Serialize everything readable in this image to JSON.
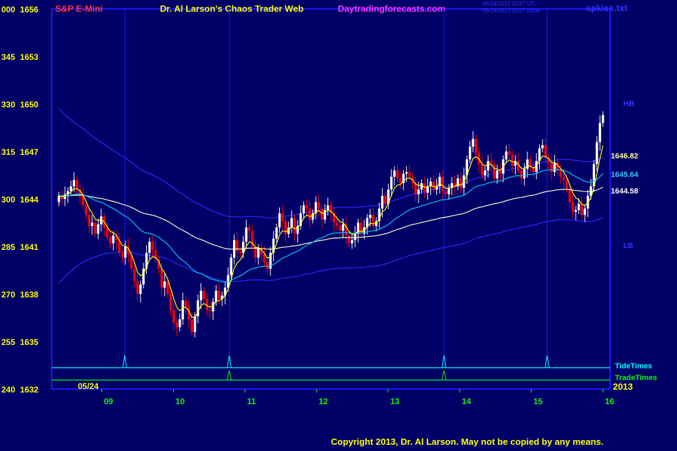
{
  "header": {
    "symbol": "S&P E-Mini",
    "title": "Dr. Al Larson's Chaos Trader Web",
    "site": "Daytradingforecasts.com",
    "stamp1": "05/24/2013 20:07 UT",
    "stamp2": "05/24/2013 15:07 Local",
    "file": "spkiss.txt"
  },
  "footer": {
    "copyright": "Copyright 2013, Dr. Al Larson. May not be copied by any means."
  },
  "colors": {
    "background": "#000066",
    "frame": "#1a1aff",
    "up_candle": "#ffffff",
    "down_candle": "#ff0000",
    "fast_avg": "#ffff00",
    "mid_avg": "#00ccff",
    "slow_avg": "#ffffcc",
    "bands": "#2a2aff",
    "tide": "#00ffff",
    "trade": "#00ff00"
  },
  "chart_data": {
    "type": "candlestick",
    "title": "S&P E-Mini",
    "date_label": "05/24",
    "year_label": "2013",
    "y_axis": {
      "range": [
        1632,
        1656
      ],
      "ticks": [
        {
          "left": "000",
          "price": "1656",
          "value": 1656
        },
        {
          "left": "345",
          "price": "1653",
          "value": 1653
        },
        {
          "left": "330",
          "price": "1650",
          "value": 1650
        },
        {
          "left": "315",
          "price": "1647",
          "value": 1647
        },
        {
          "left": "300",
          "price": "1644",
          "value": 1644
        },
        {
          "left": "285",
          "price": "1641",
          "value": 1641
        },
        {
          "left": "270",
          "price": "1638",
          "value": 1638
        },
        {
          "left": "255",
          "price": "1635",
          "value": 1635
        },
        {
          "left": "240",
          "price": "1632",
          "value": 1632
        }
      ]
    },
    "x_axis": {
      "range_hours": [
        8.3,
        16.1
      ],
      "ticks": [
        {
          "label": "09",
          "hour": 9
        },
        {
          "label": "10",
          "hour": 10
        },
        {
          "label": "11",
          "hour": 11
        },
        {
          "label": "12",
          "hour": 12
        },
        {
          "label": "13",
          "hour": 13
        },
        {
          "label": "14",
          "hour": 14
        },
        {
          "label": "15",
          "hour": 15
        },
        {
          "label": "16",
          "hour": 16
        }
      ]
    },
    "candle_closes": [
      1644.2,
      1644.0,
      1644.3,
      1644.5,
      1644.8,
      1645.2,
      1644.6,
      1644.2,
      1643.6,
      1643.0,
      1642.3,
      1642.5,
      1641.8,
      1642.4,
      1642.9,
      1642.2,
      1641.6,
      1641.2,
      1641.7,
      1641.4,
      1640.6,
      1640.3,
      1641.0,
      1640.5,
      1639.6,
      1638.8,
      1638.0,
      1638.6,
      1639.6,
      1640.6,
      1641.3,
      1640.8,
      1640.2,
      1639.6,
      1638.4,
      1638.8,
      1638.0,
      1637.0,
      1636.2,
      1635.9,
      1636.4,
      1637.6,
      1637.2,
      1636.4,
      1635.6,
      1636.6,
      1637.6,
      1638.2,
      1637.7,
      1637.0,
      1636.9,
      1637.5,
      1638.2,
      1637.7,
      1637.9,
      1638.4,
      1639.2,
      1640.3,
      1641.4,
      1640.7,
      1640.6,
      1641.3,
      1642.2,
      1642.0,
      1641.0,
      1640.3,
      1640.9,
      1640.5,
      1640.0,
      1639.6,
      1640.6,
      1641.5,
      1642.2,
      1643.1,
      1642.6,
      1641.8,
      1642.2,
      1642.8,
      1641.8,
      1642.3,
      1643.1,
      1643.6,
      1643.4,
      1642.7,
      1643.1,
      1643.8,
      1643.4,
      1642.7,
      1643.3,
      1643.6,
      1643.1,
      1642.5,
      1642.3,
      1642.0,
      1642.4,
      1641.7,
      1641.2,
      1641.4,
      1641.8,
      1642.5,
      1641.8,
      1642.2,
      1642.8,
      1643.0,
      1642.3,
      1642.6,
      1643.4,
      1644.2,
      1643.7,
      1644.6,
      1645.4,
      1645.8,
      1645.3,
      1645.0,
      1645.6,
      1645.7,
      1645.4,
      1645.0,
      1644.3,
      1644.6,
      1645.0,
      1644.4,
      1644.8,
      1645.1,
      1644.6,
      1644.8,
      1645.4,
      1644.5,
      1644.3,
      1644.7,
      1645.0,
      1644.8,
      1645.3,
      1644.7,
      1645.5,
      1646.5,
      1647.3,
      1647.8,
      1646.9,
      1646.2,
      1645.5,
      1645.8,
      1646.4,
      1646.2,
      1645.3,
      1645.8,
      1645.6,
      1646.5,
      1647.0,
      1646.8,
      1646.1,
      1646.4,
      1645.8,
      1645.3,
      1645.9,
      1646.5,
      1646.0,
      1645.7,
      1646.4,
      1647.2,
      1647.4,
      1646.6,
      1646.3,
      1645.7,
      1646.3,
      1645.8,
      1645.4,
      1645.2,
      1644.6,
      1643.8,
      1643.2,
      1643.3,
      1643.7,
      1643.0,
      1643.4,
      1644.2,
      1644.8,
      1646.2,
      1647.6,
      1648.8,
      1649.3
    ]
  },
  "overlays": {
    "tide_times_label": "TideTimes",
    "trade_times_label": "TradeTimes",
    "hb_label": "HB",
    "lb_label": "LB",
    "level_1": "1646.82",
    "level_2": "1645.64",
    "level_3": "1644.58"
  }
}
